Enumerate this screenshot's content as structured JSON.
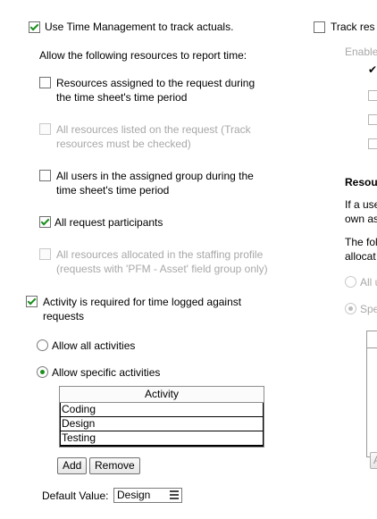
{
  "left": {
    "use_time_mgmt": {
      "label": "Use Time Management to track actuals.",
      "checked": true
    },
    "allow_heading": "Allow the following resources to report time:",
    "options": [
      {
        "line1": "Resources assigned to the request during",
        "line2": "the time sheet's time period",
        "checked": false,
        "disabled": false
      },
      {
        "line1": "All resources listed on the request (Track",
        "line2": "resources must be checked)",
        "checked": false,
        "disabled": true
      },
      {
        "line1": "All users in the assigned group during the",
        "line2": "time sheet's time period",
        "checked": false,
        "disabled": false
      },
      {
        "line1": "All request participants",
        "line2": "",
        "checked": true,
        "disabled": false
      },
      {
        "line1": "All resources allocated in the staffing profile",
        "line2": "(requests with 'PFM - Asset' field group only)",
        "checked": false,
        "disabled": true
      }
    ],
    "activity_required": {
      "line1": "Activity is required for time logged against",
      "line2": "requests",
      "checked": true
    },
    "radio_all": {
      "label": "Allow all activities",
      "selected": false
    },
    "radio_specific": {
      "label": "Allow specific activities",
      "selected": true
    },
    "activity_table": {
      "header": "Activity",
      "rows": [
        "Coding",
        "Design",
        "Testing"
      ]
    },
    "buttons": {
      "add": "Add",
      "remove": "Remove"
    },
    "default_value": {
      "label": "Default Value:",
      "value": "Design"
    }
  },
  "right": {
    "track_res": "Track res",
    "enable": "Enable",
    "checkmark": "✔",
    "resou_heading": "Resou",
    "if_a_use": "If a use",
    "own_as": "own as",
    "the_fol": "The fol",
    "allocat": "allocat",
    "all_u": "All u",
    "spe": "Spe",
    "small_btn": "A"
  }
}
